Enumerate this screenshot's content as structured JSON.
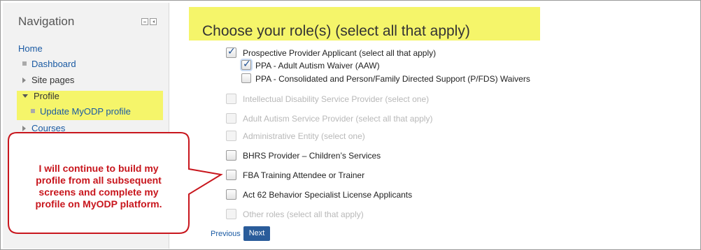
{
  "sidebar": {
    "title": "Navigation",
    "home": "Home",
    "items": [
      {
        "label": "Dashboard"
      },
      {
        "label": "Site pages"
      },
      {
        "label": "Profile"
      },
      {
        "label": "Update MyODP profile"
      },
      {
        "label": "Courses"
      }
    ]
  },
  "main": {
    "title": "Choose your role(s) (select all that apply)",
    "options": [
      {
        "label": "Prospective Provider Applicant (select all that apply)",
        "checked": true,
        "disabled": false
      },
      {
        "label": "PPA - Adult Autism Waiver (AAW)",
        "checked": true,
        "disabled": false
      },
      {
        "label": "PPA - Consolidated and Person/Family Directed Support (P/FDS) Waivers",
        "checked": false,
        "disabled": false
      },
      {
        "label": "Intellectual Disability Service Provider (select one)",
        "checked": false,
        "disabled": true
      },
      {
        "label": "Adult Autism Service Provider (select all that apply)",
        "checked": false,
        "disabled": true
      },
      {
        "label": "Administrative Entity (select one)",
        "checked": false,
        "disabled": true
      },
      {
        "label": "BHRS Provider – Children’s Services",
        "checked": false,
        "disabled": false
      },
      {
        "label": "FBA Training Attendee or Trainer",
        "checked": false,
        "disabled": false
      },
      {
        "label": "Act 62 Behavior Specialist License Applicants",
        "checked": false,
        "disabled": false
      },
      {
        "label": "Other roles (select all that apply)",
        "checked": false,
        "disabled": true
      }
    ],
    "previous_label": "Previous",
    "next_label": "Next"
  },
  "callout": {
    "lines": [
      "I will continue to build my",
      "profile from all subsequent",
      "screens and complete my",
      "profile on MyODP platform."
    ],
    "text_color": "#c8161d"
  },
  "colors": {
    "highlight": "#f5f56a",
    "link": "#1a5aa3",
    "next_button": "#2a5c9a"
  }
}
